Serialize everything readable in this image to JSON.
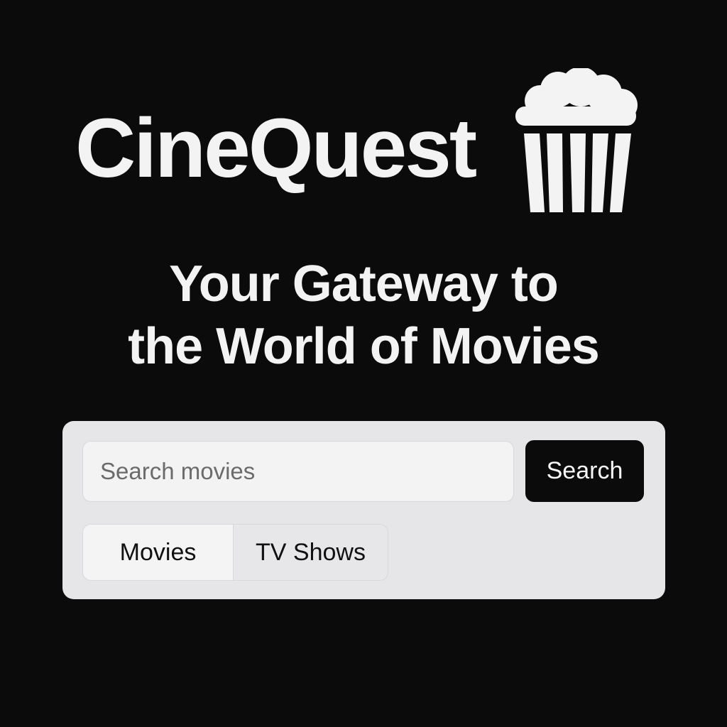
{
  "brand": {
    "name": "CineQuest",
    "logo_icon": "popcorn-bucket-icon"
  },
  "hero": {
    "line1": "Your Gateway to",
    "line2": "the World of Movies"
  },
  "search": {
    "placeholder": "Search movies",
    "value": "",
    "button_label": "Search"
  },
  "filters": {
    "tabs": [
      {
        "label": "Movies",
        "selected": true
      },
      {
        "label": "TV Shows",
        "selected": false
      }
    ]
  },
  "colors": {
    "background": "#0b0b0b",
    "text_primary": "#f3f3f3",
    "panel": "#e6e6e9",
    "input": "#f3f3f3",
    "button": "#0b0b0b",
    "button_text": "#f7f7f7"
  }
}
